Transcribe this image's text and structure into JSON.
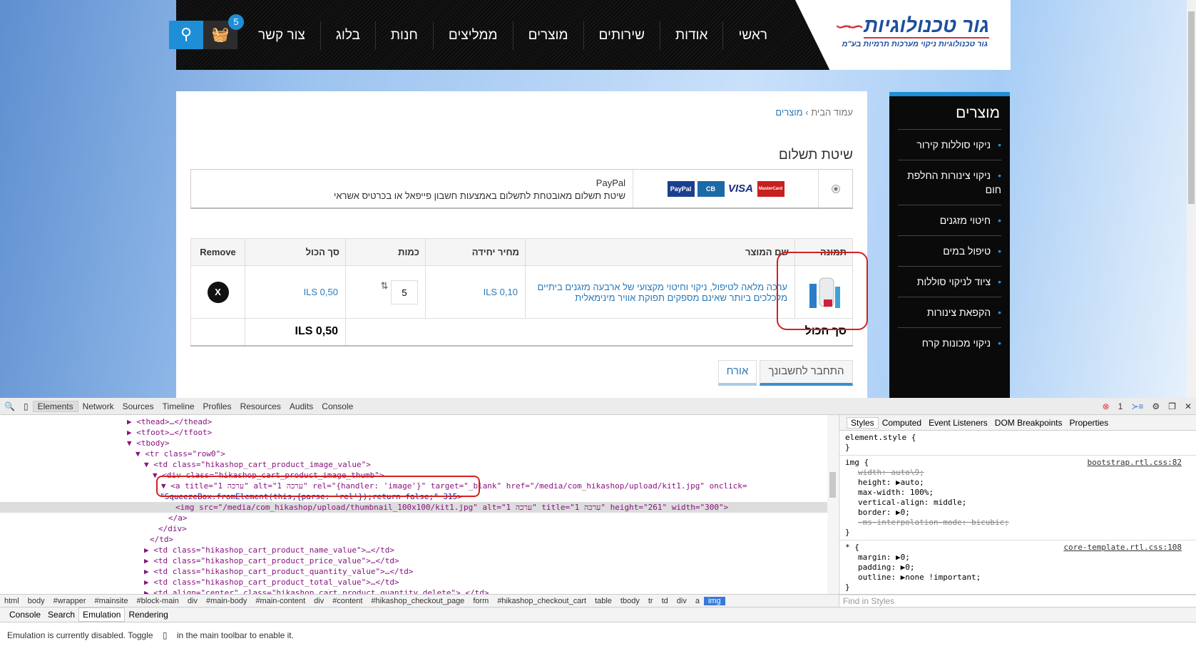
{
  "site": {
    "logo": {
      "name": "גור טכנולוגיות",
      "tagline": "גור טכנולוגיות ניקוי מערכות תרמיות בע\"מ"
    },
    "menu": [
      "ראשי",
      "אודות",
      "שירותים",
      "מוצרים",
      "ממליצים",
      "חנות",
      "בלוג",
      "צור קשר"
    ],
    "cart_count": "5",
    "breadcrumb": {
      "home": "עמוד הבית",
      "sep": "›",
      "current": "מוצרים"
    },
    "payment": {
      "title": "שיטת תשלום",
      "method": "PayPal",
      "description": "שיטת תשלום מאובטחת לתשלום באמצעות חשבון פייפאל או בכרטיס אשראי",
      "cards": [
        "PayPal",
        "CB",
        "VISA",
        "MasterCard"
      ]
    },
    "cart": {
      "headers": [
        "תמונה",
        "שם המוצר",
        "מחיר יחידה",
        "כמות",
        "סך הכול",
        "Remove"
      ],
      "row": {
        "name": "ערכה מלאה לטיפול, ניקוי וחיטוי מקצועי של ארבעה מזגנים ביתיים מלכלכים ביותר שאינם מספקים תפוקת אוויר מינימאלית",
        "unit_price": "ILS 0,10",
        "quantity": "5",
        "total": "ILS 0,50",
        "remove": "X"
      },
      "footer_label": "סך הכול",
      "footer_total": "ILS 0,50"
    },
    "tabs": [
      "התחבר לחשבונך",
      "אורח"
    ],
    "sidebar": {
      "title": "מוצרים",
      "items": [
        "ניקוי סוללות קירור",
        "ניקוי צינורות החלפת חום",
        "חיטוי מזגנים",
        "טיפול במים",
        "ציוד לניקוי סוללות",
        "הקפאת צינורות",
        "ניקוי מכונות קרח"
      ]
    }
  },
  "devtools": {
    "tabs": [
      "Elements",
      "Network",
      "Sources",
      "Timeline",
      "Profiles",
      "Resources",
      "Audits",
      "Console"
    ],
    "error_count": "1",
    "dom": [
      "<thead>…</thead>",
      "<tfoot>…</tfoot>",
      "<tbody>",
      "<tr class=\"row0\">",
      "<td class=\"hikashop_cart_product_image_value\">",
      "<div class=\"hikashop_cart_product_image_thumb\">",
      "<a title=\"1 ערכה\" alt=\"1 ערכה\" rel=\"{handler: 'image'}\" target=\"_blank\" href=\"/media/com_hikashop/upload/kit1.jpg\" onclick=",
      "\"SqueezeBox.fromElement(this,{parse: 'rel'});return false;\" 315>",
      "<img src=\"/media/com_hikashop/upload/thumbnail_100x100/kit1.jpg\" alt=\"1 ערכה\" title=\"1 ערכה\" height=\"261\" width=\"300\">",
      "</a>",
      "</div>",
      "</td>",
      "<td class=\"hikashop_cart_product_name_value\">…</td>",
      "<td class=\"hikashop_cart_product_price_value\">…</td>",
      "<td class=\"hikashop_cart_product_quantity_value\">…</td>",
      "<td class=\"hikashop_cart_product_total_value\">…</td>",
      "<td align=\"center\" class=\"hikashop_cart_product_quantity_delete\">…</td>"
    ],
    "crumbs": [
      "html",
      "body",
      "#wrapper",
      "#mainsite",
      "#block-main",
      "div",
      "#main-body",
      "#main-content",
      "div",
      "#content",
      "#hikashop_checkout_page",
      "form",
      "#hikashop_checkout_cart",
      "table",
      "tbody",
      "tr",
      "td",
      "div",
      "a",
      "img"
    ],
    "style_tabs": [
      "Styles",
      "Computed",
      "Event Listeners",
      "DOM Breakpoints",
      "Properties"
    ],
    "rules": [
      {
        "sel": "element.style {",
        "src": "",
        "props": []
      },
      {
        "sel": "img {",
        "src": "bootstrap.rtl.css:82",
        "props": [
          "width: auto\\9;",
          "height: ▶auto;",
          "max-width: 100%;",
          "vertical-align: middle;",
          "border: ▶0;",
          "-ms-interpolation-mode: bicubic;"
        ]
      },
      {
        "sel": "* {",
        "src": "core-template.rtl.css:108",
        "props": [
          "margin: ▶0;",
          "padding: ▶0;",
          "outline: ▶none !important;"
        ]
      }
    ],
    "find_placeholder": "Find in Styles",
    "drawer_tabs": [
      "Console",
      "Search",
      "Emulation",
      "Rendering"
    ],
    "emulation_msg_1": "Emulation is currently disabled. Toggle",
    "emulation_msg_2": "in the main toolbar to enable it."
  }
}
